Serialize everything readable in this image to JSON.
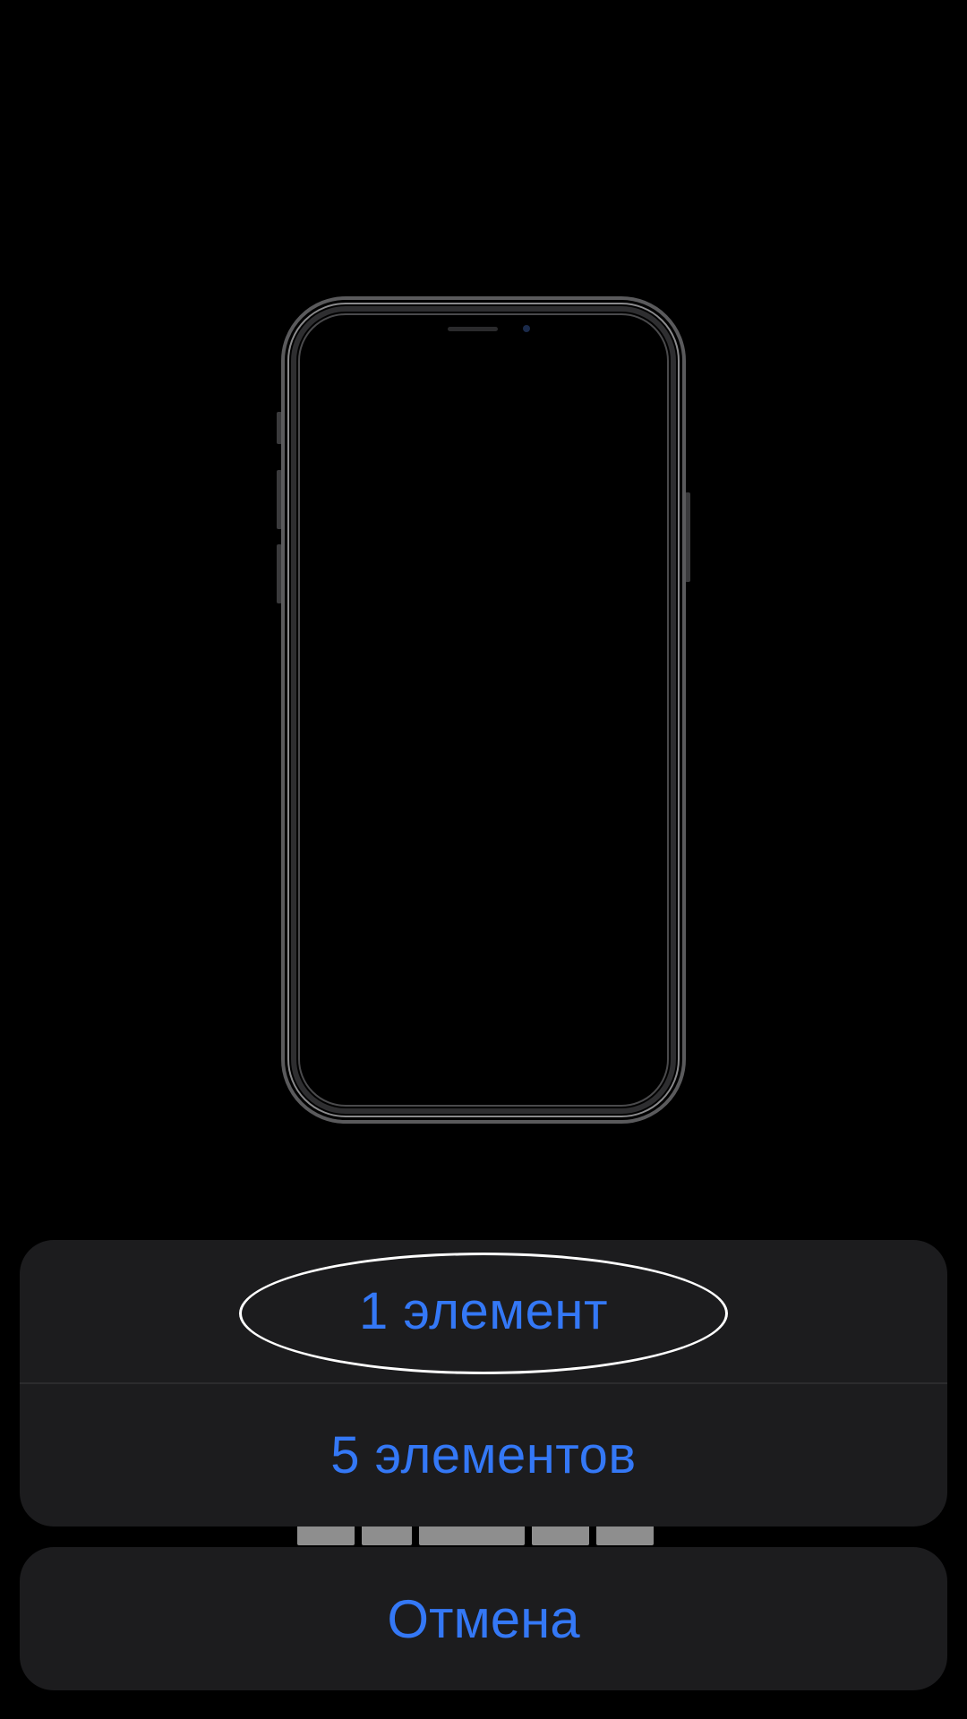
{
  "illustration": {
    "icon": "iphone-outline-icon"
  },
  "action_sheet": {
    "options": [
      {
        "label": "1 элемент",
        "focused": true
      },
      {
        "label": "5 элементов",
        "focused": false
      }
    ],
    "cancel_label": "Отмена"
  },
  "colors": {
    "background": "#000000",
    "sheet_background": "#1c1c1e",
    "action_text": "#3478f6",
    "divider": "#2c2c2e",
    "focus_ring": "#ffffff"
  }
}
